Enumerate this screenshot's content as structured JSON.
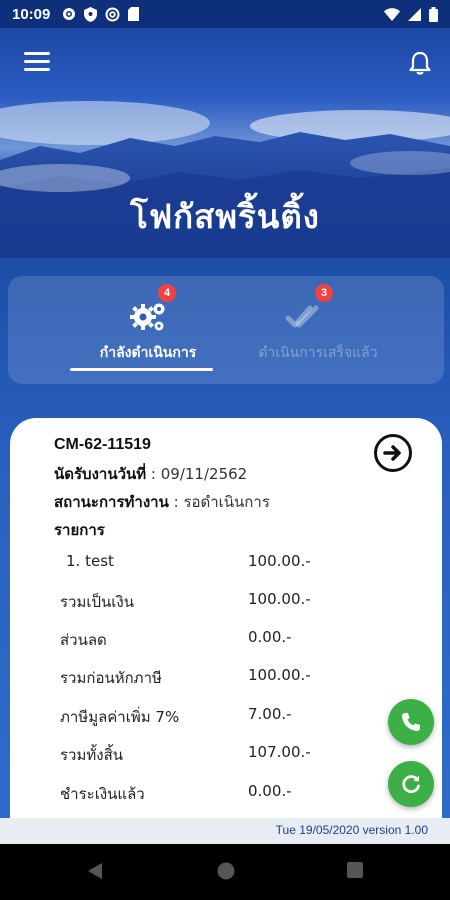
{
  "status_bar": {
    "time": "10:09",
    "left_icons": [
      "gear-icon",
      "shield-icon",
      "at-sign-icon",
      "sd-card-icon"
    ],
    "right_icons": [
      "wifi-icon",
      "signal-icon",
      "battery-icon"
    ]
  },
  "header": {
    "title": "โฟกัสพริ้นติ้ง",
    "menu_icon": "hamburger-menu-icon",
    "notification_icon": "bell-icon"
  },
  "tabs": [
    {
      "label": "กำลังดำเนินการ",
      "badge": "4",
      "icon": "gears-icon",
      "active": true
    },
    {
      "label": "ดำเนินการเสร็จแล้ว",
      "badge": "3",
      "icon": "double-check-icon",
      "active": false
    }
  ],
  "order": {
    "number": "CM-62-11519",
    "appointment_label": "นัดรับงานวันที่",
    "appointment_value": ": 09/11/2562",
    "status_label": "สถานะการทำงาน",
    "status_value": ": รอดำเนินการ",
    "items_label": "รายการ",
    "lines": [
      {
        "label": "1. test",
        "amount": "100.00.-"
      },
      {
        "label": "รวมเป็นเงิน",
        "amount": "100.00.-"
      },
      {
        "label": "ส่วนลด",
        "amount": "0.00.-"
      },
      {
        "label": "รวมก่อนหักภาษี",
        "amount": "100.00.-"
      },
      {
        "label": "ภาษีมูลค่าเพิ่ม 7%",
        "amount": "7.00.-"
      },
      {
        "label": "รวมทั้งสิ้น",
        "amount": "107.00.-"
      },
      {
        "label": "ชำระเงินแล้ว",
        "amount": "0.00.-"
      }
    ]
  },
  "fabs": [
    "phone-icon",
    "refresh-icon"
  ],
  "footer": {
    "text": "Tue 19/05/2020 version 1.00"
  },
  "colors": {
    "accent_green": "#3caf47",
    "badge_red": "#ef4343",
    "header_blue": "#0e2f7a"
  }
}
